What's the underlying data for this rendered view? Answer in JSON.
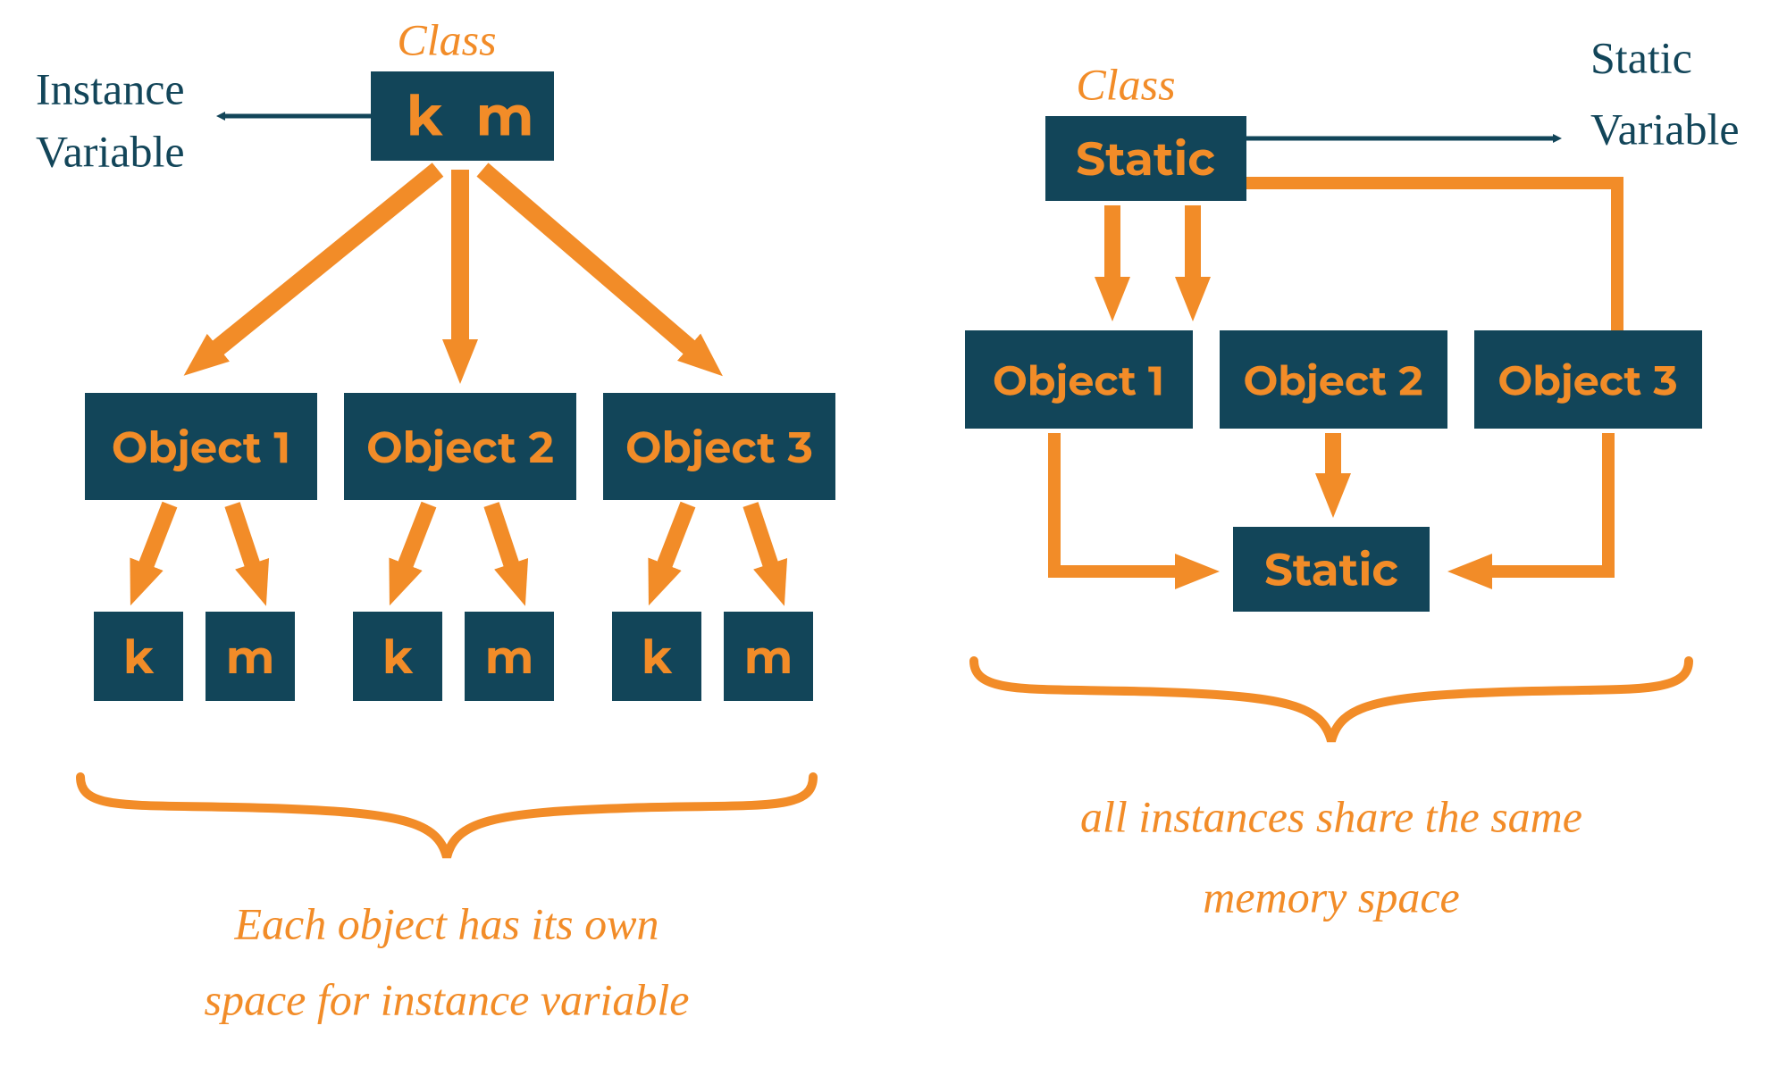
{
  "left": {
    "heading": "Class",
    "topLabel": "Instance\nVariable",
    "classBox": {
      "var1": "k",
      "var2": "m"
    },
    "objects": [
      "Object 1",
      "Object 2",
      "Object 3"
    ],
    "vars": [
      "k",
      "m"
    ],
    "caption1": "Each object has its own",
    "caption2": "space for instance variable"
  },
  "right": {
    "heading": "Class",
    "topLabel": "Static\nVariable",
    "classBox": "Static",
    "objects": [
      "Object 1",
      "Object 2",
      "Object 3"
    ],
    "sharedBox": "Static",
    "caption1": "all instances share the same",
    "caption2": "memory space"
  }
}
